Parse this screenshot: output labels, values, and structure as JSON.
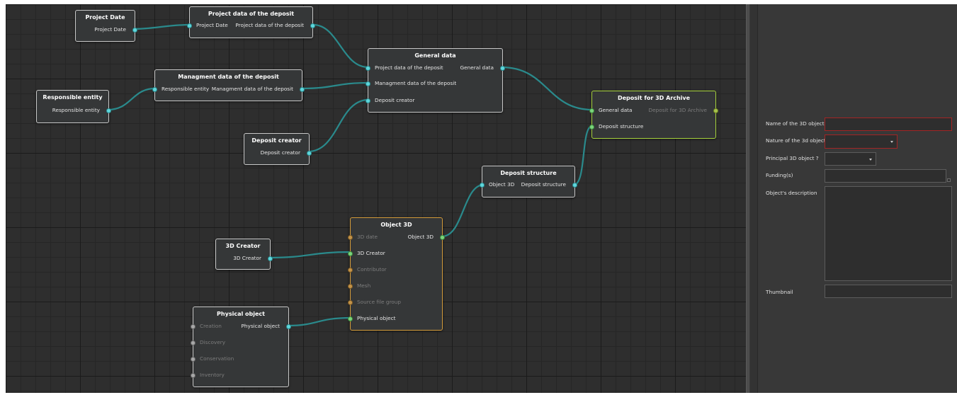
{
  "graph": {
    "nodes": {
      "project_date": {
        "title": "Project Date",
        "outputs": [
          "Project Date"
        ]
      },
      "project_data": {
        "title": "Project data of the deposit",
        "inputs": [
          "Project Date"
        ],
        "outputs": [
          "Project data of the deposit"
        ]
      },
      "general_data": {
        "title": "General data",
        "inputs": [
          "Project data of the deposit",
          "Managment data of the deposit",
          "Deposit creator"
        ],
        "outputs": [
          "General data"
        ]
      },
      "managment_data": {
        "title": "Managment data of the deposit",
        "inputs": [
          "Responsible entity"
        ],
        "outputs": [
          "Managment data of the deposit"
        ]
      },
      "responsible_entity": {
        "title": "Responsible entity",
        "outputs": [
          "Responsible entity"
        ]
      },
      "deposit_creator": {
        "title": "Deposit creator",
        "outputs": [
          "Deposit creator"
        ]
      },
      "deposit_archive": {
        "title": "Deposit for 3D Archive",
        "inputs": [
          "General data",
          "Deposit structure"
        ],
        "outputs": [
          "Deposit for 3D Archive"
        ]
      },
      "deposit_structure": {
        "title": "Deposit structure",
        "inputs": [
          "Object 3D"
        ],
        "outputs": [
          "Deposit structure"
        ]
      },
      "object_3d": {
        "title": "Object 3D",
        "inputs": [
          "3D date",
          "3D Creator",
          "Contributor",
          "Mesh",
          "Source file group",
          "Physical object"
        ],
        "outputs": [
          "Object 3D"
        ]
      },
      "creator_3d": {
        "title": "3D Creator",
        "outputs": [
          "3D Creator"
        ]
      },
      "physical_object": {
        "title": "Physical object",
        "inputs": [
          "Creation",
          "Discovery",
          "Conservation",
          "Inventory"
        ],
        "outputs": [
          "Physical object"
        ]
      }
    }
  },
  "properties": {
    "name_label": "Name of the 3D object",
    "name_value": "",
    "nature_label": "Nature of the 3d object",
    "nature_value": "",
    "principal_label": "Principal 3D object ?",
    "principal_value": "",
    "funding_label": "Funding(s)",
    "funding_value": "",
    "description_label": "Object's description",
    "description_value": "",
    "thumbnail_label": "Thumbnail",
    "thumbnail_value": ""
  },
  "colors": {
    "canvas_bg": "#2e2e2e",
    "wire": "#2a8a8c",
    "pin_cyan": "#5fd7dc",
    "pin_green": "#7cd47e",
    "node_orange_border": "#d29a3a",
    "node_green_border": "#a6d23c",
    "error_border": "#a32525"
  }
}
